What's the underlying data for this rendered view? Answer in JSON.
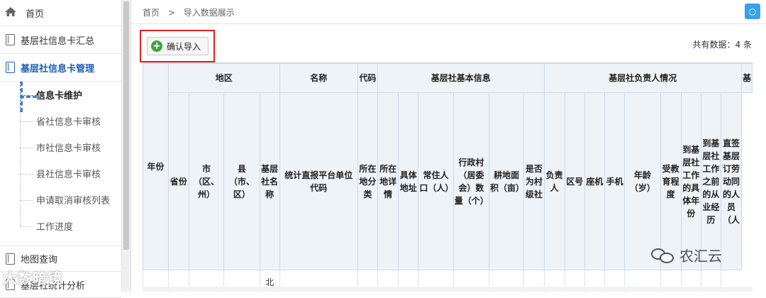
{
  "sidebar": {
    "home": "首页",
    "items": [
      {
        "label": "基层社信息卡汇总"
      },
      {
        "label": "基层社信息卡管理"
      }
    ],
    "subitems": [
      {
        "label": "信息卡维护"
      },
      {
        "label": "省社信息卡审核"
      },
      {
        "label": "市社信息卡审核"
      },
      {
        "label": "县社信息卡审核"
      },
      {
        "label": "申请取消审核列表"
      },
      {
        "label": "工作进度"
      }
    ],
    "more": [
      {
        "label": "地图查询"
      },
      {
        "label": "基层社统计分析"
      }
    ]
  },
  "breadcrumb": {
    "home": "首页",
    "sep": ">",
    "current": "导入数据展示"
  },
  "top_button": "○",
  "toolbar": {
    "confirm_label": "确认导入",
    "total": "共有数据：4 条"
  },
  "table": {
    "h1": {
      "year": "年份",
      "region": "地区",
      "name": "名称",
      "code": "代码",
      "basic": "基层社基本信息",
      "leader": "基层社负责人情况",
      "extra": "基"
    },
    "h1_name_top": "名",
    "h2": {
      "prov": "省份",
      "city": "市（区、州）",
      "county": "县（市、区）",
      "coopname": "基层社名称",
      "stat": "统计直报平台单位代码",
      "loc_class": "所在地分类",
      "loc_detail": "所在地详情",
      "address": "具体地址",
      "population": "常住人口（人）",
      "villages": "行政村（居委会）数量（个）",
      "farmland": "耕地面积（亩）",
      "village_level": "是否为村级社",
      "leader": "负责人",
      "areacode": "区号",
      "landline": "座机",
      "mobile": "手机",
      "age": "年龄（岁）",
      "education": "受教育程度",
      "start_year": "到基层社工作的具体年份",
      "prev_job": "到基层社工作之前的从业经历",
      "contract": "直签基层订劳动同的人员（人"
    },
    "first_row_cell": "北"
  },
  "watermark": {
    "brand": "农汇云",
    "corner": "大数暗镜"
  },
  "colors": {
    "accent": "#1a5fb4",
    "highlight": "#e02020",
    "header_bg": "#eef3f8",
    "plus": "#3aa63a"
  }
}
